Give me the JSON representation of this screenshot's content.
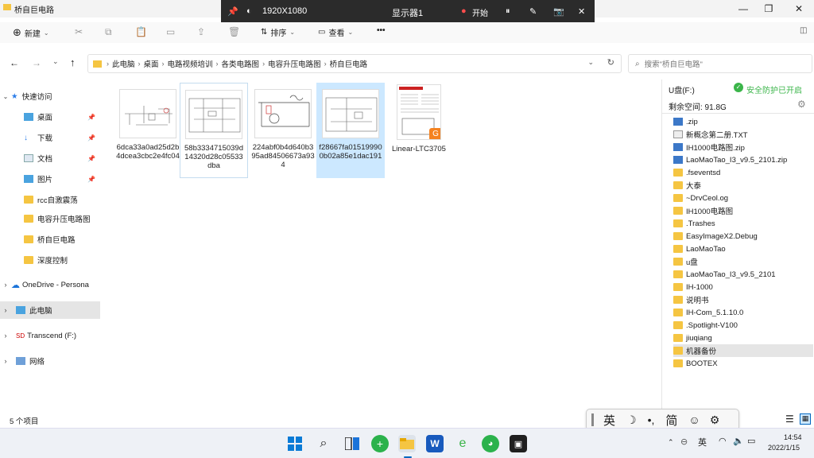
{
  "window": {
    "title": "桥自巨电路"
  },
  "recorder": {
    "resolution": "1920X1080",
    "display": "显示器1",
    "start": "开始"
  },
  "toolbar": {
    "new": "新建",
    "sort": "排序",
    "view": "查看",
    "more": "•••"
  },
  "address": {
    "crumbs": [
      "此电脑",
      "桌面",
      "电路视频培训",
      "各类电路图",
      "电容升压电路图",
      "桥自巨电路"
    ]
  },
  "search": {
    "placeholder": "搜索\"桥自巨电路\""
  },
  "nav": {
    "quick_access": "快速访问",
    "items": [
      "桌面",
      "下载",
      "文档",
      "图片",
      "rcc自激震荡",
      "电容升压电路图",
      "桥自巨电路",
      "深度控制"
    ],
    "onedrive": "OneDrive - Persona",
    "this_pc": "此电脑",
    "transcend": "Transcend (F:)",
    "network": "网络"
  },
  "files": [
    {
      "name": "6dca33a0ad25d2b4dcea3cbc2e4fc04"
    },
    {
      "name": "58b3334715039d14320d28c05533dba"
    },
    {
      "name": "224abf0b4d640b395ad84506673a934"
    },
    {
      "name": "f28667fa015199900b02a85e1dac191"
    },
    {
      "name": "Linear-LTC3705"
    }
  ],
  "panel": {
    "drive": "U盘(F:)",
    "protect": "安全防护已开启",
    "free": "剩余空间: 91.8G",
    "items": [
      ".zip",
      "新概念第二册.TXT",
      "IH1000电路图.zip",
      "LaoMaoTao_I3_v9.5_2101.zip",
      ".fseventsd",
      "大泰",
      "~DrvCeol.og",
      "IH1000电路图",
      ".Trashes",
      "EasyImageX2.Debug",
      "LaoMaoTao",
      "u盘",
      "LaoMaoTao_I3_v9.5_2101",
      "IH-1000",
      "说明书",
      "IH-Com_5.1.10.0",
      ".Spotlight-V100",
      "jiuqiang",
      "机器备份",
      "BOOTEX"
    ]
  },
  "status": {
    "count": "5 个项目"
  },
  "ime": {
    "lang": "英",
    "simp": "简"
  },
  "tray": {
    "lang": "英",
    "time": "14:54",
    "date": "2022/1/15"
  },
  "colors": {
    "accent": "#0067c0",
    "folder": "#f5c542",
    "selected": "#cce8ff"
  }
}
